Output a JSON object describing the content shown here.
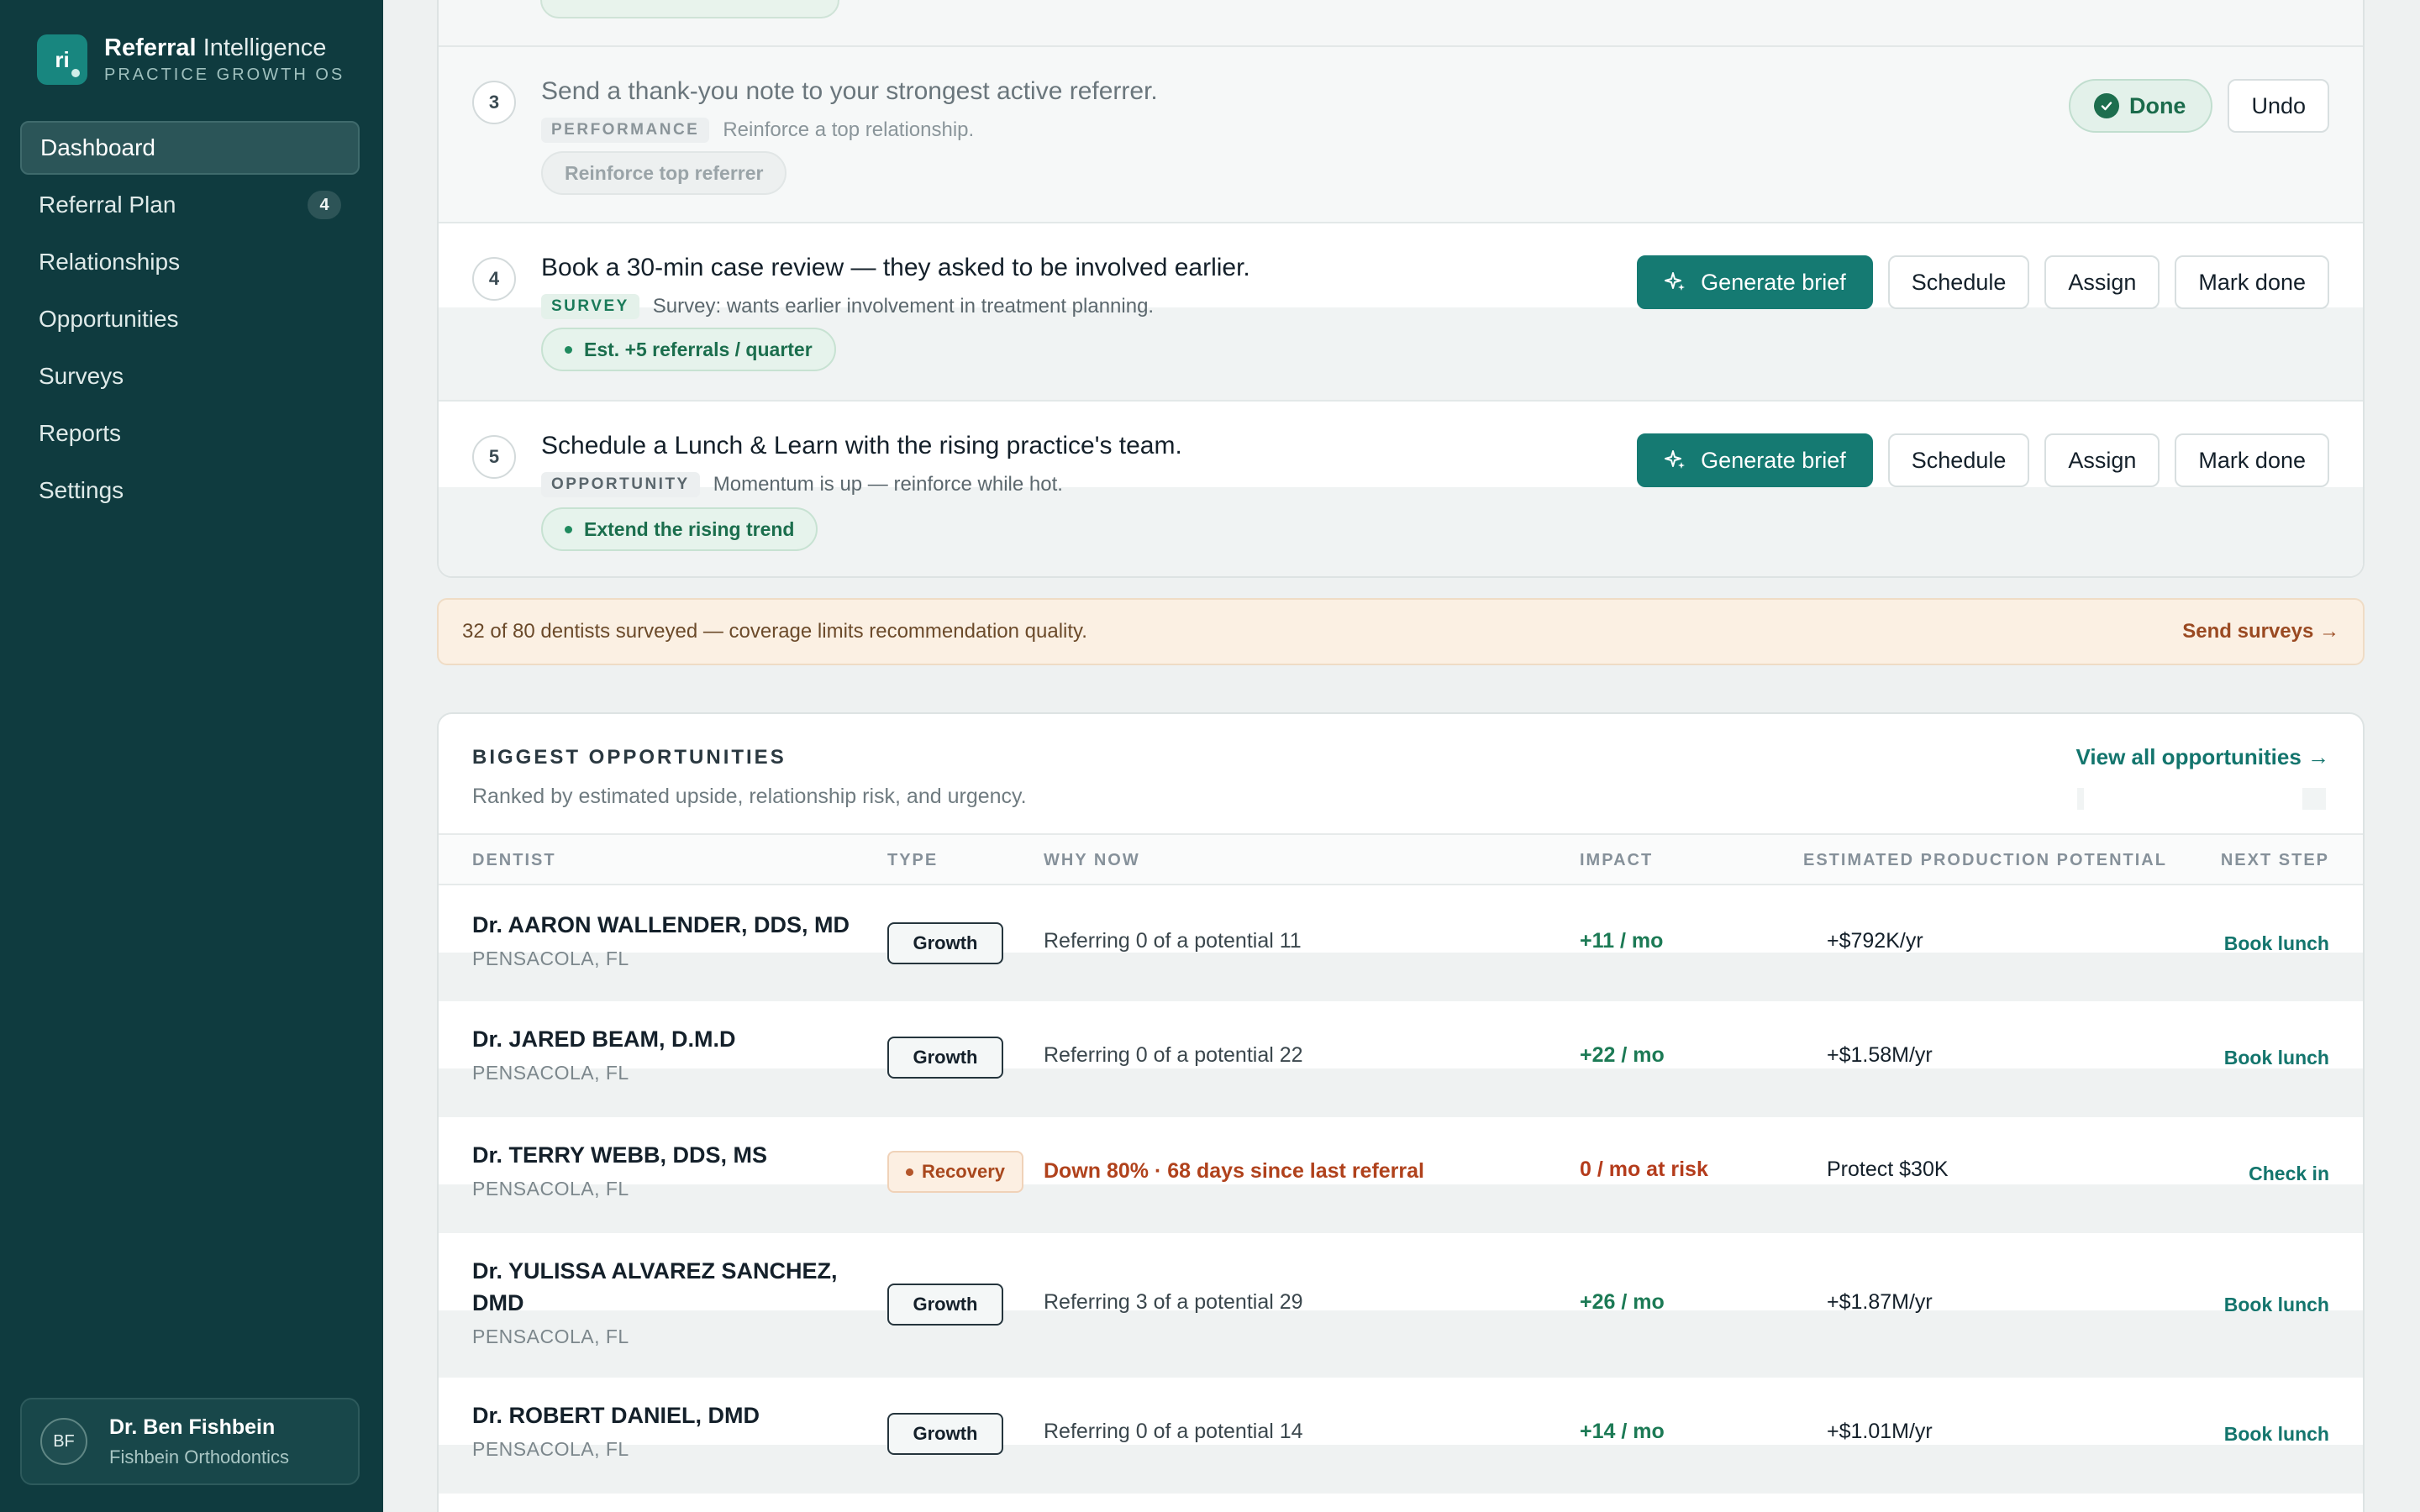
{
  "brand": {
    "logo_text": "ri",
    "title_bold": "Referral",
    "title_light": "Intelligence",
    "subtitle": "PRACTICE GROWTH OS"
  },
  "nav": [
    {
      "label": "Dashboard",
      "active": true
    },
    {
      "label": "Referral Plan",
      "badge": "4"
    },
    {
      "label": "Relationships"
    },
    {
      "label": "Opportunities"
    },
    {
      "label": "Surveys"
    },
    {
      "label": "Reports"
    },
    {
      "label": "Settings"
    }
  ],
  "user": {
    "initials": "BF",
    "name": "Dr. Ben Fishbein",
    "org": "Fishbein Orthodontics"
  },
  "plan": {
    "steps": [
      {
        "num": "3",
        "title": "Send a thank-you note to your strongest active referrer.",
        "tag": "PERFORMANCE",
        "desc": "Reinforce a top relationship.",
        "pill": "Reinforce top referrer",
        "done_label": "Done",
        "undo_label": "Undo"
      },
      {
        "num": "4",
        "title": "Book a 30-min case review — they asked to be involved earlier.",
        "tag": "SURVEY",
        "desc": "Survey: wants earlier involvement in treatment planning.",
        "pill": "Est. +5 referrals / quarter",
        "actions": [
          "Generate brief",
          "Schedule",
          "Assign",
          "Mark done"
        ]
      },
      {
        "num": "5",
        "title": "Schedule a Lunch & Learn with the rising practice's team.",
        "tag": "OPPORTUNITY",
        "desc": "Momentum is up — reinforce while hot.",
        "pill": "Extend the rising trend",
        "actions": [
          "Generate brief",
          "Schedule",
          "Assign",
          "Mark done"
        ]
      }
    ]
  },
  "banner": {
    "text": "32 of 80 dentists surveyed — coverage limits recommendation quality.",
    "link": "Send surveys →"
  },
  "opportunities": {
    "title": "BIGGEST OPPORTUNITIES",
    "subtitle": "Ranked by estimated upside, relationship risk, and urgency.",
    "view_all": "View all opportunities →",
    "columns": [
      "DENTIST",
      "TYPE",
      "WHY NOW",
      "IMPACT",
      "ESTIMATED PRODUCTION POTENTIAL",
      "NEXT STEP"
    ],
    "rows": [
      {
        "name": "Dr. AARON WALLENDER, DDS, MD",
        "location": "PENSACOLA, FL",
        "type": "Growth",
        "why": "Referring 0 of a potential 11",
        "impact": "+11 / mo",
        "potential": "+$792K/yr",
        "next": "Book lunch"
      },
      {
        "name": "Dr. JARED BEAM, D.M.D",
        "location": "PENSACOLA, FL",
        "type": "Growth",
        "why": "Referring 0 of a potential 22",
        "impact": "+22 / mo",
        "potential": "+$1.58M/yr",
        "next": "Book lunch"
      },
      {
        "name": "Dr. TERRY WEBB, DDS, MS",
        "location": "PENSACOLA, FL",
        "type": "Recovery",
        "why": "Down 80% · 68 days since last referral",
        "impact": "0 / mo at risk",
        "potential": "Protect $30K",
        "next": "Check in"
      },
      {
        "name": "Dr. YULISSA ALVAREZ SANCHEZ, DMD",
        "location": "PENSACOLA, FL",
        "type": "Growth",
        "why": "Referring 3 of a potential 29",
        "impact": "+26 / mo",
        "potential": "+$1.87M/yr",
        "next": "Book lunch"
      },
      {
        "name": "Dr. ROBERT DANIEL, DMD",
        "location": "PENSACOLA, FL",
        "type": "Growth",
        "why": "Referring 0 of a potential 14",
        "impact": "+14 / mo",
        "potential": "+$1.01M/yr",
        "next": "Book lunch"
      }
    ]
  },
  "colors": {
    "sidebar": "#0f3b3f",
    "accent": "#157a72",
    "growth_green": "#1c7a55",
    "risk_red": "#b43c1c",
    "warning_bg": "#fbf0e3"
  },
  "icons": {
    "generate": "sparkles-icon",
    "done": "check-circle-icon"
  }
}
